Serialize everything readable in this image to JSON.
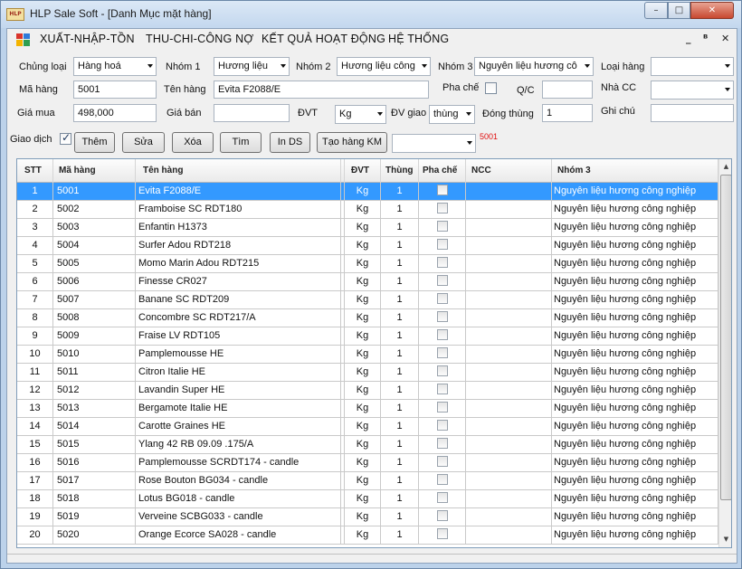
{
  "window": {
    "app_icon_text": "HLP",
    "title": "HLP Sale Soft - [Danh Mục mặt hàng]",
    "minimize_glyph": "–",
    "maximize_glyph": "□",
    "close_glyph": "✕"
  },
  "menu": {
    "items": [
      "XUẤT-NHẬP-TỒN",
      "THU-CHI-CÔNG NỢ",
      "KẾT QUẢ HOẠT ĐỘNG",
      "HỆ THỐNG"
    ],
    "mdi_min": "_",
    "mdi_restore": "ᴮ",
    "mdi_close": "✕"
  },
  "form": {
    "chung_loai": {
      "label": "Chủng loại",
      "value": "Hàng hoá"
    },
    "nhom1": {
      "label": "Nhóm 1",
      "value": "Hương liệu"
    },
    "nhom2": {
      "label": "Nhóm 2",
      "value": "Hương liệu công"
    },
    "nhom3": {
      "label": "Nhóm 3",
      "value": "Nguyên liệu hương cô"
    },
    "loai_hang": {
      "label": "Loại hàng",
      "value": ""
    },
    "ma_hang": {
      "label": "Mã hàng",
      "value": "5001"
    },
    "ten_hang": {
      "label": "Tên hàng",
      "value": "Evita F2088/E"
    },
    "pha_che": {
      "label": "Pha chế",
      "checked": false
    },
    "qc": {
      "label": "Q/C",
      "value": ""
    },
    "nha_cc": {
      "label": "Nhà CC",
      "value": ""
    },
    "gia_mua": {
      "label": "Giá mua",
      "value": "498,000"
    },
    "gia_ban": {
      "label": "Giá bán",
      "value": ""
    },
    "dvt": {
      "label": "ĐVT",
      "value": "Kg"
    },
    "dv_giao": {
      "label": "ĐV giao",
      "value": "thùng"
    },
    "dong_thung": {
      "label": "Đóng thùng",
      "value": "1"
    },
    "ghi_chu": {
      "label": "Ghi chú",
      "value": ""
    },
    "giao_dich": {
      "label": "Giao dịch",
      "checked": true
    },
    "buttons": {
      "them": "Thêm",
      "sua": "Sửa",
      "xoa": "Xóa",
      "tim": "Tìm",
      "in_ds": "In DS",
      "tao_hang_km": "Tạo hàng KM"
    },
    "km_select": "",
    "current_code": "5001"
  },
  "table": {
    "headers": {
      "stt": "STT",
      "ma_hang": "Mã hàng",
      "ten_hang": "Tên hàng",
      "dvt": "ĐVT",
      "thung": "Thùng",
      "pha_che": "Pha chế",
      "ncc": "NCC",
      "nhom3": "Nhóm 3"
    },
    "rows": [
      {
        "stt": "1",
        "ma": "5001",
        "ten": "Evita F2088/E",
        "dvt": "Kg",
        "thung": "1",
        "ncc": "",
        "nhom3": "Nguyên liệu hương công nghiệp",
        "selected": true
      },
      {
        "stt": "2",
        "ma": "5002",
        "ten": "Framboise SC RDT180",
        "dvt": "Kg",
        "thung": "1",
        "ncc": "",
        "nhom3": "Nguyên liệu hương công nghiệp"
      },
      {
        "stt": "3",
        "ma": "5003",
        "ten": "Enfantin H1373",
        "dvt": "Kg",
        "thung": "1",
        "ncc": "",
        "nhom3": "Nguyên liệu hương công nghiệp"
      },
      {
        "stt": "4",
        "ma": "5004",
        "ten": "Surfer Adou RDT218",
        "dvt": "Kg",
        "thung": "1",
        "ncc": "",
        "nhom3": "Nguyên liệu hương công nghiệp"
      },
      {
        "stt": "5",
        "ma": "5005",
        "ten": "Momo  Marin Adou RDT215",
        "dvt": "Kg",
        "thung": "1",
        "ncc": "",
        "nhom3": "Nguyên liệu hương công nghiệp"
      },
      {
        "stt": "6",
        "ma": "5006",
        "ten": "Finesse CR027",
        "dvt": "Kg",
        "thung": "1",
        "ncc": "",
        "nhom3": "Nguyên liệu hương công nghiệp"
      },
      {
        "stt": "7",
        "ma": "5007",
        "ten": "Banane SC RDT209",
        "dvt": "Kg",
        "thung": "1",
        "ncc": "",
        "nhom3": "Nguyên liệu hương công nghiệp"
      },
      {
        "stt": "8",
        "ma": "5008",
        "ten": "Concombre SC RDT217/A",
        "dvt": "Kg",
        "thung": "1",
        "ncc": "",
        "nhom3": "Nguyên liệu hương công nghiệp"
      },
      {
        "stt": "9",
        "ma": "5009",
        "ten": "Fraise LV RDT105",
        "dvt": "Kg",
        "thung": "1",
        "ncc": "",
        "nhom3": "Nguyên liệu hương công nghiệp"
      },
      {
        "stt": "10",
        "ma": "5010",
        "ten": "Pamplemousse HE",
        "dvt": "Kg",
        "thung": "1",
        "ncc": "",
        "nhom3": "Nguyên liệu hương công nghiệp"
      },
      {
        "stt": "11",
        "ma": "5011",
        "ten": "Citron Italie HE",
        "dvt": "Kg",
        "thung": "1",
        "ncc": "",
        "nhom3": "Nguyên liệu hương công nghiệp"
      },
      {
        "stt": "12",
        "ma": "5012",
        "ten": "Lavandin Super HE",
        "dvt": "Kg",
        "thung": "1",
        "ncc": "",
        "nhom3": "Nguyên liệu hương công nghiệp"
      },
      {
        "stt": "13",
        "ma": "5013",
        "ten": "Bergamote Italie HE",
        "dvt": "Kg",
        "thung": "1",
        "ncc": "",
        "nhom3": "Nguyên liệu hương công nghiệp"
      },
      {
        "stt": "14",
        "ma": "5014",
        "ten": "Carotte Graines HE",
        "dvt": "Kg",
        "thung": "1",
        "ncc": "",
        "nhom3": "Nguyên liệu hương công nghiệp"
      },
      {
        "stt": "15",
        "ma": "5015",
        "ten": "Ylang 42 RB 09.09 .175/A",
        "dvt": "Kg",
        "thung": "1",
        "ncc": "",
        "nhom3": "Nguyên liệu hương công nghiệp"
      },
      {
        "stt": "16",
        "ma": "5016",
        "ten": "Pamplemousse SCRDT174 - candle",
        "dvt": "Kg",
        "thung": "1",
        "ncc": "",
        "nhom3": "Nguyên liệu hương công nghiệp"
      },
      {
        "stt": "17",
        "ma": "5017",
        "ten": "Rose Bouton BG034 - candle",
        "dvt": "Kg",
        "thung": "1",
        "ncc": "",
        "nhom3": "Nguyên liệu hương công nghiệp"
      },
      {
        "stt": "18",
        "ma": "5018",
        "ten": "Lotus BG018 - candle",
        "dvt": "Kg",
        "thung": "1",
        "ncc": "",
        "nhom3": "Nguyên liệu hương công nghiệp"
      },
      {
        "stt": "19",
        "ma": "5019",
        "ten": "Verveine SCBG033 - candle",
        "dvt": "Kg",
        "thung": "1",
        "ncc": "",
        "nhom3": "Nguyên liệu hương công nghiệp"
      },
      {
        "stt": "20",
        "ma": "5020",
        "ten": "Orange Ecorce SA028 - candle",
        "dvt": "Kg",
        "thung": "1",
        "ncc": "",
        "nhom3": "Nguyên liệu hương công nghiệp"
      }
    ]
  },
  "colors": {
    "selection": "#3399ff",
    "accent_red": "#e01010",
    "window_frame": "#bcd2ea"
  },
  "icons": {
    "app": "hlp-logo-icon",
    "menu": "window-grid-icon",
    "scroll_up": "arrow-up-icon",
    "scroll_down": "arrow-down-icon"
  }
}
